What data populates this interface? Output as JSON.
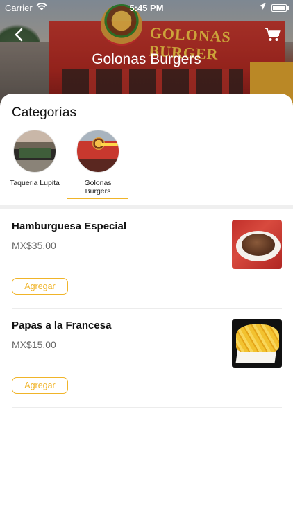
{
  "status_bar": {
    "carrier": "Carrier",
    "time": "5:45 PM"
  },
  "header": {
    "title": "Golonas Burgers",
    "sign_text": "GOLONAS BURGER"
  },
  "categories": {
    "title": "Categorías",
    "items": [
      {
        "label": "Taqueria Lupita",
        "selected": false
      },
      {
        "label": "Golonas Burgers",
        "selected": true
      }
    ]
  },
  "products": [
    {
      "name": "Hamburguesa Especial",
      "price": "MX$35.00",
      "add_label": "Agregar",
      "image": "burger-photo"
    },
    {
      "name": "Papas a la Francesa",
      "price": "MX$15.00",
      "add_label": "Agregar",
      "image": "fries-photo"
    }
  ],
  "colors": {
    "accent": "#f0b429",
    "divider": "#ececec",
    "price_text": "#666666"
  },
  "icons": {
    "back": "chevron-left-icon",
    "cart": "cart-icon",
    "wifi": "wifi-icon",
    "location": "location-arrow-icon",
    "battery": "battery-icon"
  }
}
